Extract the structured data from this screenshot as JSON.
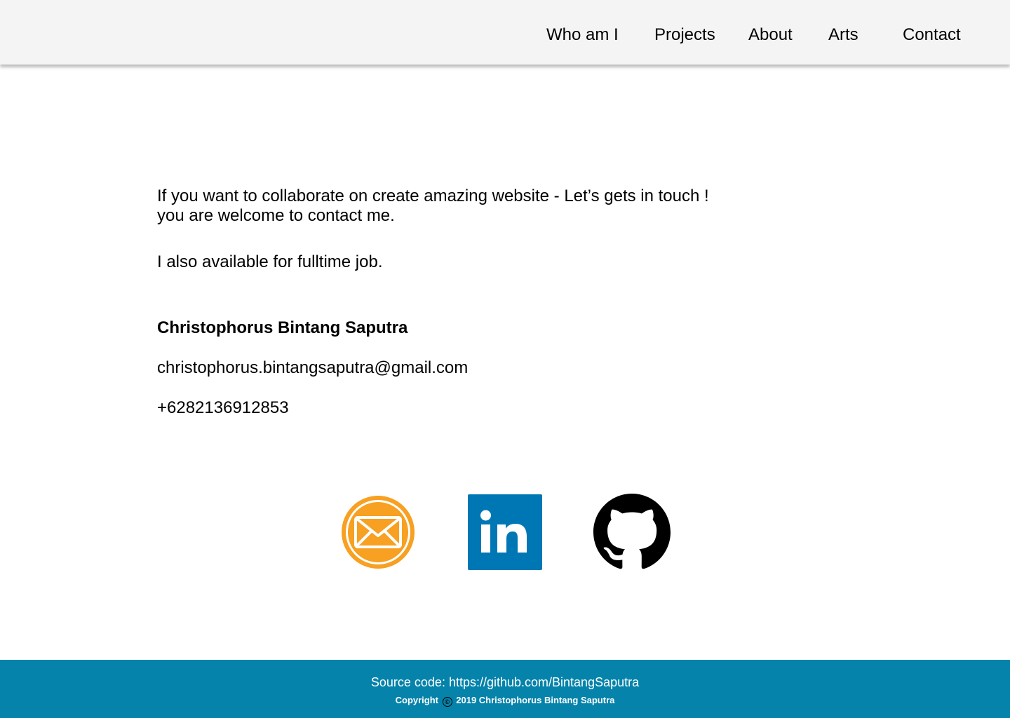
{
  "nav": {
    "items": [
      {
        "label": "Who am I"
      },
      {
        "label": "Projects"
      },
      {
        "label": "About"
      },
      {
        "label": "Arts"
      },
      {
        "label": "Contact"
      }
    ]
  },
  "contact": {
    "intro_line1": "If you want to collaborate on create amazing website - Let’s gets in touch !",
    "intro_line2": "you are welcome to contact me.",
    "fulltime": "I also available for fulltime job.",
    "name": "Christophorus Bintang Saputra",
    "email": "christophorus.bintangsaputra@gmail.com",
    "phone": "+6282136912853"
  },
  "social": {
    "icons": [
      {
        "icon": "mail-icon",
        "color": "#f7a021"
      },
      {
        "icon": "linkedin-icon",
        "color": "#0077b5"
      },
      {
        "icon": "github-icon",
        "color": "#000000"
      }
    ]
  },
  "footer": {
    "source": "Source code: https://github.com/BintangSaputra",
    "copyright_prefix": "Copyright",
    "copyright_symbol": "©",
    "copyright_suffix": "2019 Christophorus Bintang Saputra",
    "background": "#0583aa"
  },
  "colors": {
    "header_bg": "#f4f4f4",
    "text": "#000000"
  }
}
